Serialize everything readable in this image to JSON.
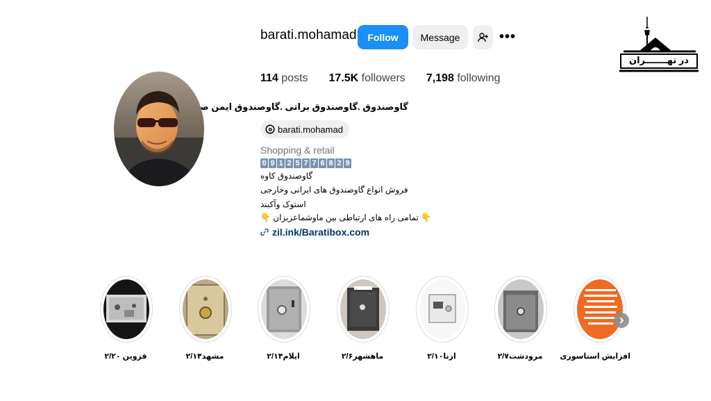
{
  "profile": {
    "username": "barati.mohamad",
    "follow_label": "Follow",
    "message_label": "Message",
    "more_label": "•••",
    "stats": [
      {
        "value": "114",
        "label": "posts"
      },
      {
        "value": "17.5K",
        "label": "followers"
      },
      {
        "value": "7,198",
        "label": "following"
      }
    ],
    "full_name": "گاوصندوق .گاوصندوق براتی .گاوصندوق ایمن صنعت",
    "threads_handle": "barati.mohamad",
    "category": "Shopping & retail",
    "phone_digits": [
      "0",
      "9",
      "1",
      "2",
      "5",
      "7",
      "7",
      "6",
      "8",
      "2",
      "9"
    ],
    "bio_lines": [
      "گاوصندوق کاوه",
      "فروش انواع گاوصندوق های ایرانی وخارجی",
      "استوک وآکبند",
      "👇 تمامی راه های ارتباطی بین ماوشماعزیزان 👇"
    ],
    "link": "zil.ink/Baratibox.com"
  },
  "highlights": [
    {
      "label": "قزوین ۲/۲۰"
    },
    {
      "label": "مشهد۲/۱۴"
    },
    {
      "label": "ایلام۲/۱۴"
    },
    {
      "label": "ماهشهر۲/۶"
    },
    {
      "label": "ازنا۲/۱۰"
    },
    {
      "label": "مرودشت۲/۷"
    },
    {
      "label": "افزایش استاسوری"
    }
  ],
  "logo": {
    "text": "در تهـــــــران"
  },
  "icons": {
    "suggest": "person-add-icon",
    "threads": "threads-icon",
    "link": "link-icon",
    "next": "chevron-right-icon"
  },
  "colors": {
    "follow": "#1a8ff5",
    "secondary_button": "#efefef",
    "link": "#00376b",
    "muted": "#737373"
  }
}
